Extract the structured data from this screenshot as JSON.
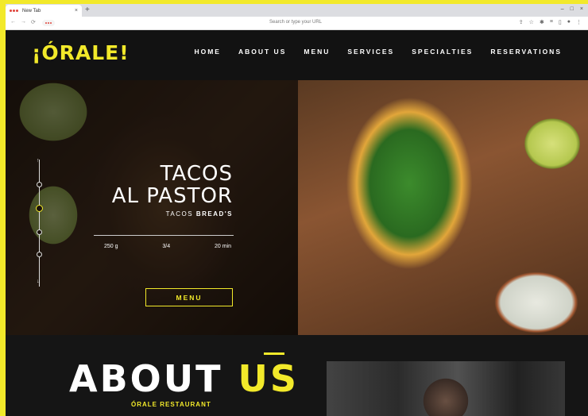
{
  "browser": {
    "tab_title": "New Tab",
    "tab_close": "×",
    "new_tab": "+",
    "address_placeholder": "Search or type your URL",
    "window_controls": [
      "–",
      "□",
      "×"
    ]
  },
  "site": {
    "logo": "¡ÓRALE!",
    "nav": [
      "HOME",
      "ABOUT US",
      "MENU",
      "SERVICES",
      "SPECIALTIES",
      "RESERVATIONS"
    ],
    "hero": {
      "title_line1": "TACOS",
      "title_line2": "AL PASTOR",
      "subtitle_prefix": "TACOS",
      "subtitle_bold": "BREAD'S",
      "stats": [
        "250 g",
        "3/4",
        "20 min"
      ],
      "button": "MENU"
    },
    "about": {
      "title_main": "ABOUT",
      "title_accent": "US",
      "subtitle": "ÓRALE RESTAURANT"
    }
  },
  "colors": {
    "accent": "#f2e92a",
    "background": "#121212"
  }
}
